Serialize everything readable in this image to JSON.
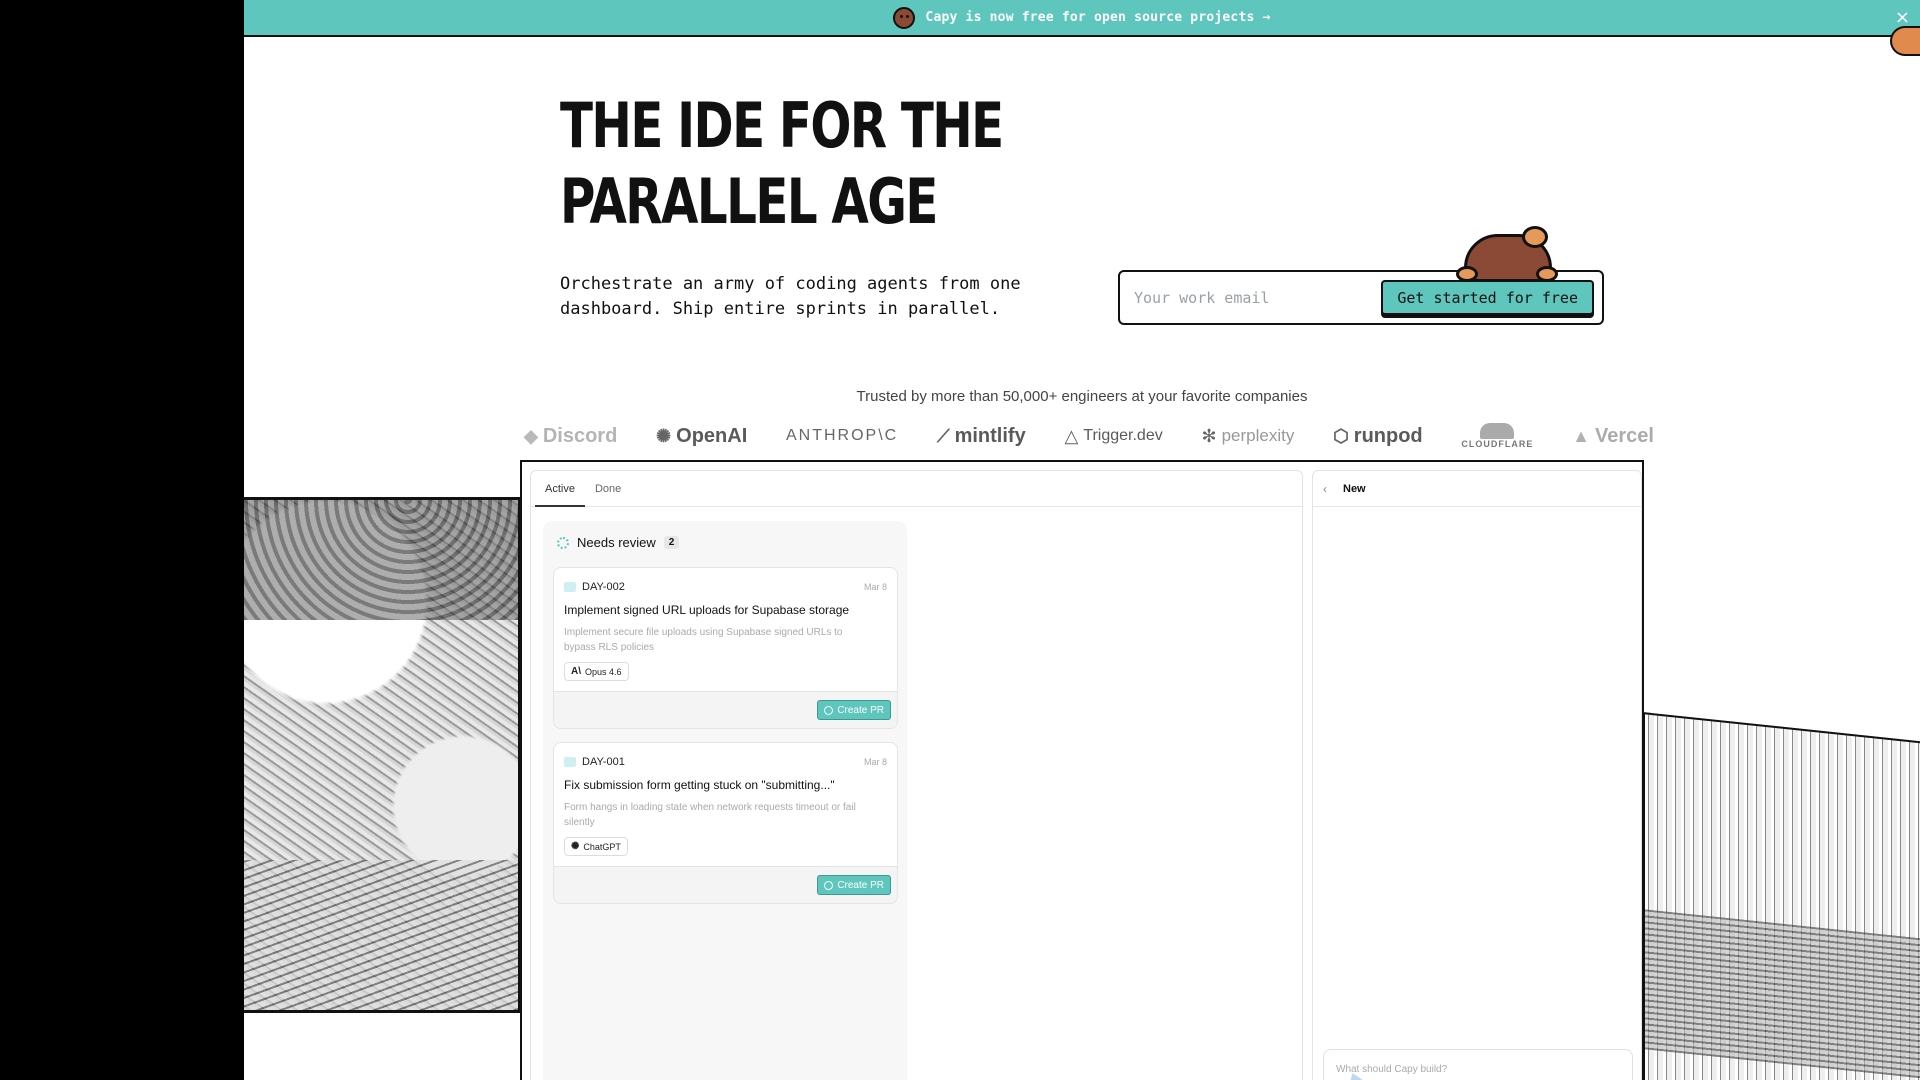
{
  "banner": {
    "text": "Capy is now free for open source projects →",
    "close": "×"
  },
  "hero": {
    "title_line1": "THE IDE FOR THE",
    "title_line2": "PARALLEL AGE",
    "subtitle_line1": "Orchestrate an army of coding agents from one",
    "subtitle_line2": "dashboard. Ship entire sprints in parallel."
  },
  "signup": {
    "placeholder": "Your work email",
    "cta": "Get started for free"
  },
  "trusted": {
    "text": "Trusted by more than 50,000+ engineers at your favorite companies"
  },
  "logos": [
    {
      "name": "Discord",
      "glyph": "◆"
    },
    {
      "name": "OpenAI",
      "glyph": "✺"
    },
    {
      "name": "ANTHROP\\C",
      "glyph": ""
    },
    {
      "name": "mintlify",
      "glyph": "⟋"
    },
    {
      "name": "Trigger.dev",
      "glyph": "△"
    },
    {
      "name": "perplexity",
      "glyph": "✻"
    },
    {
      "name": "runpod",
      "glyph": "⬡"
    },
    {
      "name": "CLOUDFLARE",
      "glyph": ""
    },
    {
      "name": "Vercel",
      "glyph": "▲"
    }
  ],
  "board": {
    "tabs": [
      "Active",
      "Done"
    ],
    "column": {
      "label": "Needs review",
      "count": "2"
    },
    "cards": [
      {
        "id": "DAY-002",
        "date": "Mar 8",
        "title": "Implement signed URL uploads for Supabase storage",
        "desc": "Implement secure file uploads using Supabase signed URLs to bypass RLS policies",
        "model_icon": "A\\",
        "model": "Opus 4.6",
        "action": "Create PR"
      },
      {
        "id": "DAY-001",
        "date": "Mar 8",
        "title": "Fix submission form getting stuck on \"submitting...\"",
        "desc": "Form hangs in loading state when network requests timeout or fail silently",
        "model_icon": "✺",
        "model": "ChatGPT",
        "action": "Create PR"
      }
    ]
  },
  "chat": {
    "back": "‹",
    "label": "New",
    "placeholder": "What should Capy build?"
  }
}
